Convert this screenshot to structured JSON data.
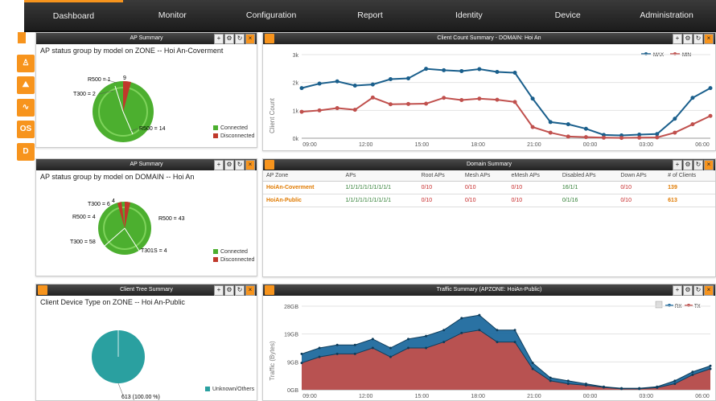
{
  "nav": {
    "items": [
      "Dashboard",
      "Monitor",
      "Configuration",
      "Report",
      "Identity",
      "Device",
      "Administration"
    ],
    "active": "Dashboard"
  },
  "sidebar": {
    "buttons": [
      "OS",
      "D"
    ]
  },
  "ap_summary_zone": {
    "header": "AP Summary",
    "title": "AP status group by model on ZONE -- Hoi An-Coverment",
    "labels": [
      "R500 = 1",
      "T300 = 2",
      "R500 = 14"
    ],
    "top_label": "9",
    "legend": [
      "Connected",
      "Disconnected"
    ]
  },
  "ap_summary_domain": {
    "header": "AP Summary",
    "title": "AP status group by model on DOMAIN -- Hoi An",
    "labels": [
      "T300 = 6",
      "R500 = 4",
      "T300 = 58",
      "R500 = 43",
      "T301S = 4"
    ],
    "top_label": "4",
    "legend": [
      "Connected",
      "Disconnected"
    ]
  },
  "client_tree": {
    "header": "Client Tree Summary",
    "title": "Client Device Type on ZONE -- Hoi An-Public",
    "slice_label": "613 (100.00 %)",
    "legend": [
      "Unknown/Others"
    ]
  },
  "client_count": {
    "header": "Client Count Summary - DOMAIN: Hoi An",
    "ylabel": "Client Count",
    "legend": [
      "MAX",
      "MIN"
    ]
  },
  "domain_summary": {
    "header": "Domain Summary",
    "columns": [
      "AP Zone",
      "APs",
      "Root APs",
      "Mesh APs",
      "eMesh APs",
      "Disabled APs",
      "Down APs",
      "# of Clients"
    ],
    "rows": [
      {
        "zone": "HoiAn-Coverment",
        "aps": "1/1/1/1/1/1/1/1/1/1",
        "root": "0/10",
        "mesh": "0/10",
        "emesh": "0/10",
        "disabled": "16/1/1",
        "down": "0/10",
        "clients": "139"
      },
      {
        "zone": "HoiAn-Public",
        "aps": "1/1/1/1/1/1/1/1/1/1",
        "root": "0/10",
        "mesh": "0/10",
        "emesh": "0/10",
        "disabled": "0/1/16",
        "down": "0/10",
        "clients": "613"
      }
    ]
  },
  "traffic": {
    "header": "Traffic Summary (APZONE: HoiAn-Public)",
    "ylabel": "Traffic (Bytes)",
    "legend": [
      "RX",
      "TX"
    ]
  },
  "chart_data": [
    {
      "type": "line",
      "title": "Client Count Summary - DOMAIN: Hoi An",
      "xlabel": "",
      "ylabel": "Client Count",
      "x_ticks": [
        "09:00",
        "12:00",
        "15:00",
        "18:00",
        "21:00",
        "00:00",
        "03:00",
        "06:00"
      ],
      "y_ticks": [
        "0k",
        "1k",
        "2k",
        "3k"
      ],
      "ylim": [
        0,
        3000
      ],
      "x": [
        0,
        1,
        2,
        3,
        4,
        5,
        6,
        7,
        8,
        9,
        10,
        11,
        12,
        13,
        14,
        15,
        16,
        17,
        18,
        19,
        20,
        21,
        22,
        23
      ],
      "series": [
        {
          "name": "MAX",
          "color": "#1a5f8c",
          "values": [
            1800,
            1960,
            2040,
            1890,
            1930,
            2120,
            2150,
            2490,
            2440,
            2410,
            2480,
            2380,
            2350,
            1420,
            580,
            500,
            340,
            120,
            100,
            130,
            150,
            700,
            1450,
            1800
          ]
        },
        {
          "name": "MIN",
          "color": "#c0504d",
          "values": [
            950,
            1000,
            1080,
            1020,
            1460,
            1220,
            1230,
            1240,
            1450,
            1370,
            1420,
            1380,
            1300,
            400,
            200,
            60,
            40,
            20,
            10,
            20,
            30,
            200,
            500,
            800
          ]
        }
      ]
    },
    {
      "type": "area",
      "title": "Traffic Summary (APZONE: HoiAn-Public)",
      "xlabel": "",
      "ylabel": "Traffic (Bytes)",
      "x_ticks": [
        "09:00",
        "12:00",
        "15:00",
        "18:00",
        "21:00",
        "00:00",
        "03:00",
        "06:00"
      ],
      "y_ticks": [
        "0GB",
        "9GB",
        "19GB",
        "28GB"
      ],
      "ylim": [
        0,
        28
      ],
      "x": [
        0,
        1,
        2,
        3,
        4,
        5,
        6,
        7,
        8,
        9,
        10,
        11,
        12,
        13,
        14,
        15,
        16,
        17,
        18,
        19,
        20,
        21,
        22,
        23
      ],
      "series": [
        {
          "name": "RX",
          "color": "#1f6a9e",
          "values": [
            12,
            14,
            15,
            15,
            17,
            14,
            17,
            18,
            20,
            24,
            25,
            20,
            20,
            9,
            4,
            3,
            2,
            1,
            0.5,
            0.5,
            1,
            3,
            6,
            8
          ]
        },
        {
          "name": "TX",
          "color": "#c0504d",
          "values": [
            9,
            11,
            12,
            12,
            14,
            11,
            14,
            14,
            16,
            19,
            20,
            16,
            16,
            7,
            3,
            2,
            1.5,
            0.8,
            0.3,
            0.3,
            0.7,
            2,
            5,
            7
          ]
        }
      ]
    }
  ]
}
